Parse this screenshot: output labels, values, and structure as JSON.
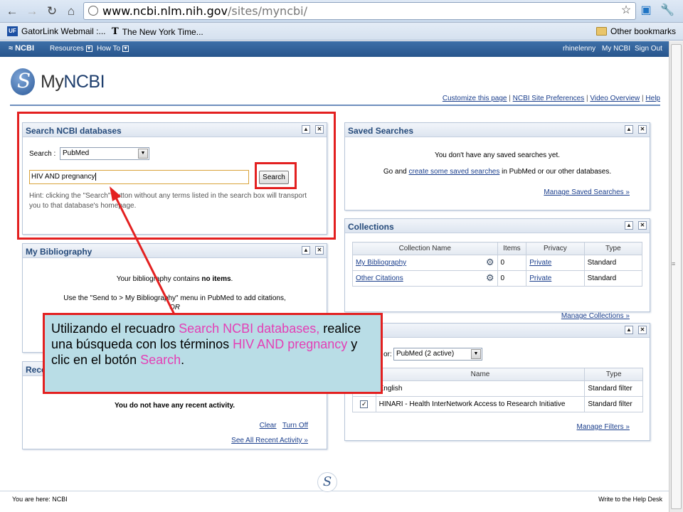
{
  "browser": {
    "url_host": "www.ncbi.nlm.nih.gov",
    "url_path": "/sites/myncbi/",
    "bookmarks": [
      {
        "icon": "UF",
        "label": "GatorLink Webmail :..."
      },
      {
        "icon": "T",
        "label": "The New York Time..."
      }
    ],
    "other_bookmarks": "Other bookmarks"
  },
  "ncbi_bar": {
    "logo": "NCBI",
    "resources": "Resources",
    "howto": "How To",
    "user": "rhinelenny",
    "my_ncbi": "My NCBI",
    "sign_out": "Sign Out"
  },
  "header": {
    "logo_my": "My",
    "logo_ncbi": "NCBI",
    "links": [
      "Customize this page",
      "NCBI Site Preferences",
      "Video Overview",
      "Help"
    ]
  },
  "search_panel": {
    "title": "Search NCBI databases",
    "search_label": "Search :",
    "db_value": "PubMed",
    "query_value": "HIV AND pregnancy",
    "button": "Search",
    "hint": "Hint: clicking the \"Search\" button without any terms listed in the search box will transport you to that database's homepage."
  },
  "saved_searches": {
    "title": "Saved Searches",
    "empty": "You don't have any saved searches yet.",
    "go_pre": "Go and",
    "go_link": "create some saved searches",
    "go_post": "in PubMed or our other databases.",
    "manage": "Manage Saved Searches »"
  },
  "bibliography": {
    "title": "My Bibliography",
    "text_pre": "Your bibliography contains",
    "text_bold": "no items",
    "text_post": ".",
    "use": "Use the \"Send to > My Bibliography\" menu in PubMed to add citations,",
    "or": "OR"
  },
  "collections": {
    "title": "Collections",
    "headers": [
      "Collection Name",
      "Items",
      "Privacy",
      "Type"
    ],
    "rows": [
      {
        "name": "My Bibliography",
        "items": "0",
        "privacy": "Private",
        "type": "Standard"
      },
      {
        "name": "Other Citations",
        "items": "0",
        "privacy": "Private",
        "type": "Standard"
      }
    ],
    "manage": "Manage Collections »"
  },
  "filters": {
    "for_label": "or:",
    "select_value": "PubMed (2 active)",
    "headers": [
      "Name",
      "Type"
    ],
    "rows": [
      {
        "name": "English",
        "type": "Standard filter"
      },
      {
        "name": "HINARI - Health InterNetwork Access to Research Initiative",
        "type": "Standard filter"
      }
    ],
    "manage": "Manage Filters »"
  },
  "recent": {
    "title_partial": "Rece",
    "empty": "You do not have any recent activity.",
    "clear": "Clear",
    "turn_off": "Turn Off",
    "see_all": "See All Recent Activity »"
  },
  "callout": {
    "p1": "Utilizando el recuadro ",
    "h1": "Search NCBI databases,",
    "p2": " realice una búsqueda con los términos ",
    "h2": "HIV AND pregnancy",
    "p3": "  y clic en el botón ",
    "h3": "Search",
    "p4": "."
  },
  "footer": {
    "here": "You are here:",
    "here_link": "NCBI",
    "help": "Write to the Help Desk"
  },
  "colors": {
    "highlight_red": "#e32020",
    "callout_bg": "#b9dde6",
    "callout_accent": "#e43fb5"
  }
}
